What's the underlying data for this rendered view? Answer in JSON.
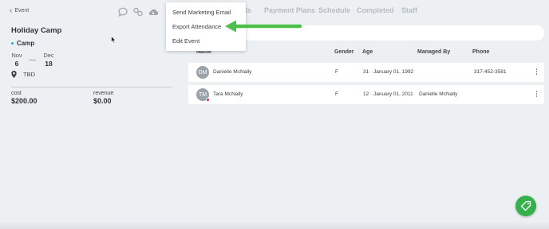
{
  "nav": {
    "back_label": "Event"
  },
  "event": {
    "title": "Holiday Camp",
    "category": "Camp",
    "start": {
      "month": "Nov",
      "day": "6"
    },
    "end": {
      "month": "Dec",
      "day": "18"
    },
    "date_separator": "—",
    "location": "TBD",
    "cost_label": "cost",
    "cost_value": "$200.00",
    "revenue_label": "revenue",
    "revenue_value": "$0.00"
  },
  "toolbar_icons": [
    "chat-icon",
    "link-icon",
    "cloud-icon"
  ],
  "tabs": [
    "ts",
    "Payment Plans",
    "Schedule",
    "Completed",
    "Staff"
  ],
  "menu": {
    "items": [
      "Send Marketing Email",
      "Export Attendance",
      "Edit Event"
    ]
  },
  "search": {
    "placeholder": ""
  },
  "table": {
    "columns": [
      "Name",
      "Gender",
      "Age",
      "Managed By",
      "Phone"
    ],
    "rows": [
      {
        "initials": "DM",
        "name": "Danielle McNally",
        "gender": "F",
        "age": "31 · January 01, 1992",
        "managed_by": "",
        "phone": "317-452-3581",
        "alert": false
      },
      {
        "initials": "TM",
        "name": "Tara McNally",
        "gender": "F",
        "age": "12 · January 01, 2011",
        "managed_by": "Danielle McNally",
        "phone": "",
        "alert": true
      }
    ]
  },
  "colors": {
    "accent_green": "#35b04a",
    "arrow_green": "#4cc04a",
    "alert_red": "#d8242c",
    "category_dot": "#3aa0d8"
  }
}
